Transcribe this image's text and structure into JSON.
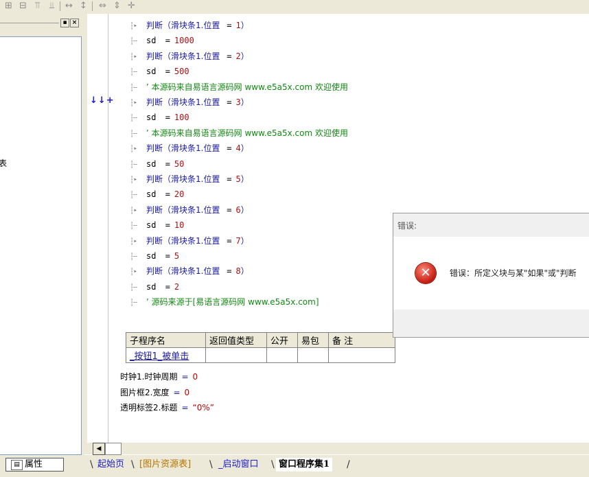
{
  "toolbar": {
    "icons": [
      "align-cols-icon",
      "align-center-icon",
      "align-top-icon",
      "align-bottom-icon",
      "space-horizontal-icon",
      "space-vertical-icon",
      "same-width-icon",
      "same-height-icon",
      "same-size-icon"
    ]
  },
  "left_panel": {
    "truncated_text": "表",
    "properties_tab": "属性"
  },
  "code": {
    "gutter_mark": "↓↓+",
    "lines": [
      {
        "kind": "judge",
        "pre": "判断（滑块条1.位置 ",
        "op": "=",
        "val": "1",
        "post": "）"
      },
      {
        "kind": "assign",
        "pre": "sd ",
        "op": "=",
        "val": "1000"
      },
      {
        "kind": "judge",
        "pre": "判断（滑块条1.位置 ",
        "op": "=",
        "val": "2",
        "post": "）"
      },
      {
        "kind": "assign",
        "pre": "sd ",
        "op": "=",
        "val": "500"
      },
      {
        "kind": "comment",
        "text": "’ 本源码来自易语言源码网 www.e5a5x.com  欢迎使用"
      },
      {
        "kind": "judge",
        "pre": "判断（滑块条1.位置 ",
        "op": "=",
        "val": "3",
        "post": "）"
      },
      {
        "kind": "assign",
        "pre": "sd ",
        "op": "=",
        "val": "100"
      },
      {
        "kind": "comment",
        "text": "’ 本源码来自易语言源码网 www.e5a5x.com  欢迎使用"
      },
      {
        "kind": "judge",
        "pre": "判断（滑块条1.位置 ",
        "op": "=",
        "val": "4",
        "post": "）"
      },
      {
        "kind": "assign",
        "pre": "sd ",
        "op": "=",
        "val": "50"
      },
      {
        "kind": "judge",
        "pre": "判断（滑块条1.位置 ",
        "op": "=",
        "val": "5",
        "post": "）"
      },
      {
        "kind": "assign",
        "pre": "sd ",
        "op": "=",
        "val": "20"
      },
      {
        "kind": "judge",
        "pre": "判断（滑块条1.位置 ",
        "op": "=",
        "val": "6",
        "post": "）"
      },
      {
        "kind": "assign",
        "pre": "sd ",
        "op": "=",
        "val": "10"
      },
      {
        "kind": "judge",
        "pre": "判断（滑块条1.位置 ",
        "op": "=",
        "val": "7",
        "post": "）"
      },
      {
        "kind": "assign",
        "pre": "sd ",
        "op": "=",
        "val": "5"
      },
      {
        "kind": "judge",
        "pre": "判断（滑块条1.位置 ",
        "op": "=",
        "val": "8",
        "post": "）"
      },
      {
        "kind": "assign",
        "pre": "sd ",
        "op": "=",
        "val": "2"
      },
      {
        "kind": "comment",
        "text": "’ 源码来源于[易语言源码网 www.e5a5x.com]"
      }
    ]
  },
  "subroutine_table": {
    "headers": [
      "子程序名",
      "返回值类型",
      "公开",
      "易包",
      "备 注"
    ],
    "rows": [
      [
        "_按钮1_被单击",
        "",
        "",
        "",
        ""
      ]
    ]
  },
  "properties": [
    {
      "name": "时钟1.时钟周期",
      "op": "=",
      "value": "0"
    },
    {
      "name": "图片框2.宽度",
      "op": "=",
      "value": "0"
    },
    {
      "name": "透明标签2.标题",
      "op": "=",
      "value": "“0%”"
    }
  ],
  "dialog": {
    "title": "错误:",
    "message": "错误：所定义块与某\"如果\"或\"判断"
  },
  "tabs": [
    "起始页",
    "[图片资源表]",
    "_启动窗口",
    "窗口程序集1"
  ]
}
